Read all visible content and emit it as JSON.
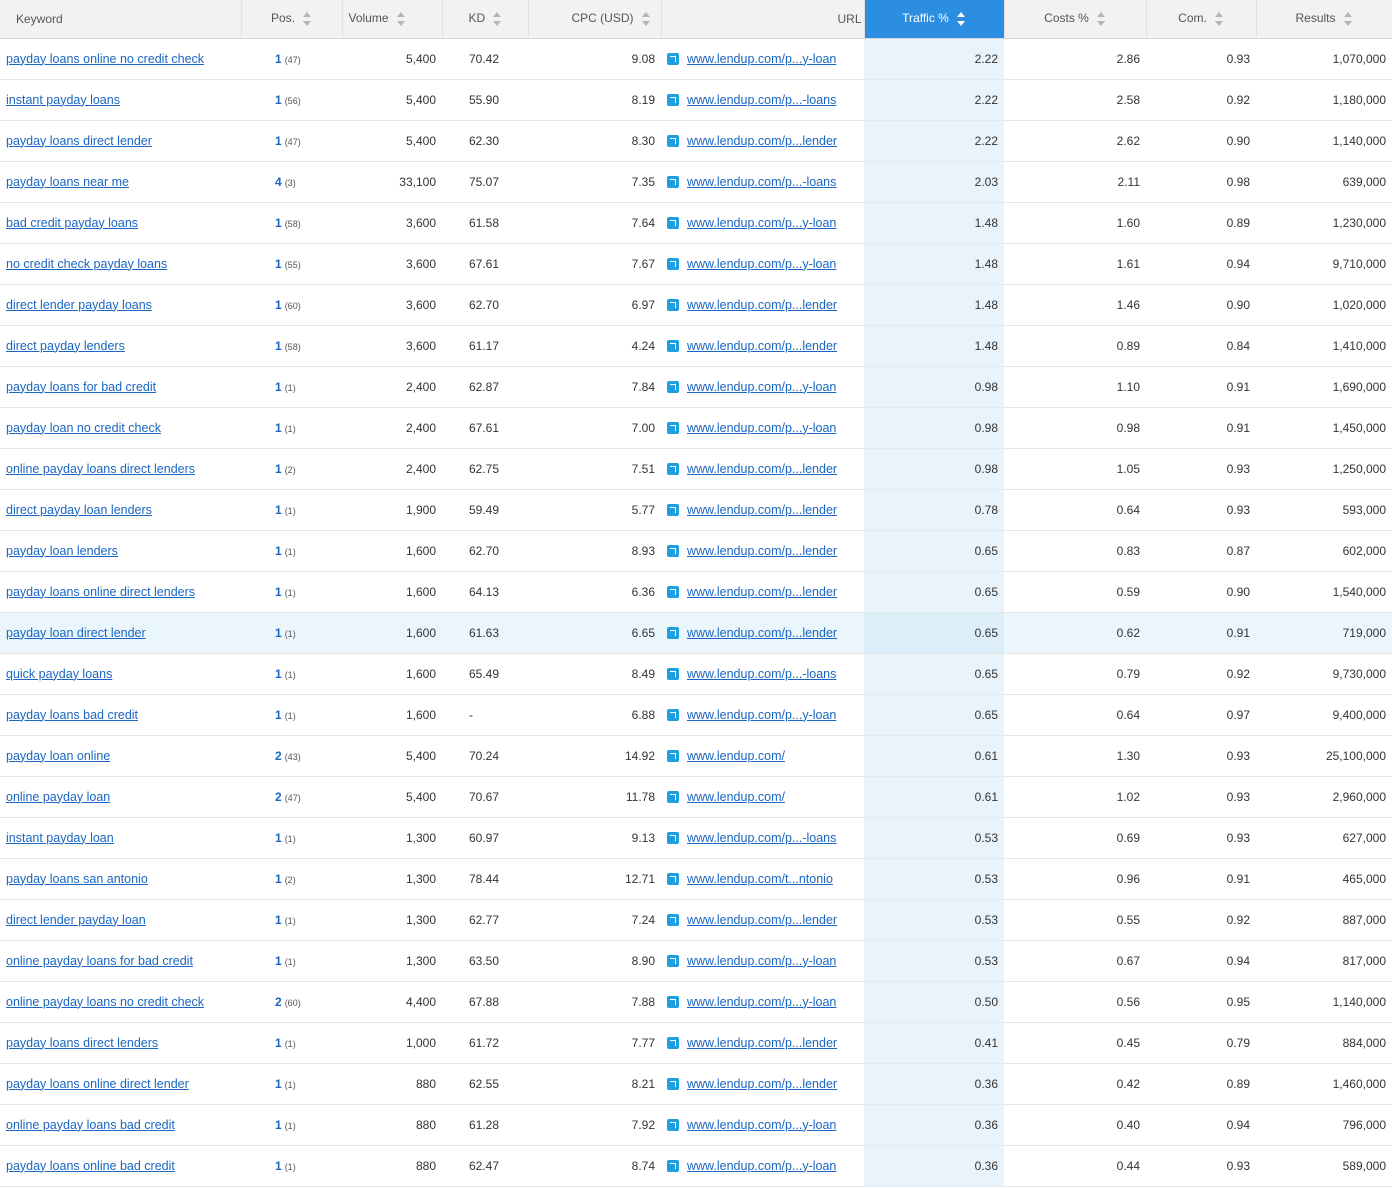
{
  "columns": {
    "keyword": "Keyword",
    "pos": "Pos.",
    "volume": "Volume",
    "kd": "KD",
    "cpc": "CPC (USD)",
    "url": "URL",
    "traffic": "Traffic %",
    "costs": "Costs %",
    "com": "Com.",
    "results": "Results"
  },
  "colors": {
    "sorted_header": "#2b8ee0",
    "link": "#1a66c2",
    "traffic_column": "#e8f3fb",
    "row_hover": "#eaf5fc"
  },
  "rows": [
    {
      "keyword": "payday loans online no credit check",
      "pos": "1",
      "prev": "(47)",
      "volume": "5,400",
      "kd": "70.42",
      "cpc": "9.08",
      "url": "www.lendup.com/p...y-loan",
      "traffic": "2.22",
      "costs": "2.86",
      "com": "0.93",
      "results": "1,070,000"
    },
    {
      "keyword": "instant payday loans",
      "pos": "1",
      "prev": "(56)",
      "volume": "5,400",
      "kd": "55.90",
      "cpc": "8.19",
      "url": "www.lendup.com/p...-loans",
      "traffic": "2.22",
      "costs": "2.58",
      "com": "0.92",
      "results": "1,180,000"
    },
    {
      "keyword": "payday loans direct lender",
      "pos": "1",
      "prev": "(47)",
      "volume": "5,400",
      "kd": "62.30",
      "cpc": "8.30",
      "url": "www.lendup.com/p...lender",
      "traffic": "2.22",
      "costs": "2.62",
      "com": "0.90",
      "results": "1,140,000"
    },
    {
      "keyword": "payday loans near me",
      "pos": "4",
      "prev": "(3)",
      "volume": "33,100",
      "kd": "75.07",
      "cpc": "7.35",
      "url": "www.lendup.com/p...-loans",
      "traffic": "2.03",
      "costs": "2.11",
      "com": "0.98",
      "results": "639,000"
    },
    {
      "keyword": "bad credit payday loans",
      "pos": "1",
      "prev": "(58)",
      "volume": "3,600",
      "kd": "61.58",
      "cpc": "7.64",
      "url": "www.lendup.com/p...y-loan",
      "traffic": "1.48",
      "costs": "1.60",
      "com": "0.89",
      "results": "1,230,000"
    },
    {
      "keyword": "no credit check payday loans",
      "pos": "1",
      "prev": "(55)",
      "volume": "3,600",
      "kd": "67.61",
      "cpc": "7.67",
      "url": "www.lendup.com/p...y-loan",
      "traffic": "1.48",
      "costs": "1.61",
      "com": "0.94",
      "results": "9,710,000"
    },
    {
      "keyword": "direct lender payday loans",
      "pos": "1",
      "prev": "(60)",
      "volume": "3,600",
      "kd": "62.70",
      "cpc": "6.97",
      "url": "www.lendup.com/p...lender",
      "traffic": "1.48",
      "costs": "1.46",
      "com": "0.90",
      "results": "1,020,000"
    },
    {
      "keyword": "direct payday lenders",
      "pos": "1",
      "prev": "(58)",
      "volume": "3,600",
      "kd": "61.17",
      "cpc": "4.24",
      "url": "www.lendup.com/p...lender",
      "traffic": "1.48",
      "costs": "0.89",
      "com": "0.84",
      "results": "1,410,000"
    },
    {
      "keyword": "payday loans for bad credit",
      "pos": "1",
      "prev": "(1)",
      "volume": "2,400",
      "kd": "62.87",
      "cpc": "7.84",
      "url": "www.lendup.com/p...y-loan",
      "traffic": "0.98",
      "costs": "1.10",
      "com": "0.91",
      "results": "1,690,000"
    },
    {
      "keyword": "payday loan no credit check",
      "pos": "1",
      "prev": "(1)",
      "volume": "2,400",
      "kd": "67.61",
      "cpc": "7.00",
      "url": "www.lendup.com/p...y-loan",
      "traffic": "0.98",
      "costs": "0.98",
      "com": "0.91",
      "results": "1,450,000"
    },
    {
      "keyword": "online payday loans direct lenders",
      "pos": "1",
      "prev": "(2)",
      "volume": "2,400",
      "kd": "62.75",
      "cpc": "7.51",
      "url": "www.lendup.com/p...lender",
      "traffic": "0.98",
      "costs": "1.05",
      "com": "0.93",
      "results": "1,250,000"
    },
    {
      "keyword": "direct payday loan lenders",
      "pos": "1",
      "prev": "(1)",
      "volume": "1,900",
      "kd": "59.49",
      "cpc": "5.77",
      "url": "www.lendup.com/p...lender",
      "traffic": "0.78",
      "costs": "0.64",
      "com": "0.93",
      "results": "593,000"
    },
    {
      "keyword": "payday loan lenders",
      "pos": "1",
      "prev": "(1)",
      "volume": "1,600",
      "kd": "62.70",
      "cpc": "8.93",
      "url": "www.lendup.com/p...lender",
      "traffic": "0.65",
      "costs": "0.83",
      "com": "0.87",
      "results": "602,000"
    },
    {
      "keyword": "payday loans online direct lenders",
      "pos": "1",
      "prev": "(1)",
      "volume": "1,600",
      "kd": "64.13",
      "cpc": "6.36",
      "url": "www.lendup.com/p...lender",
      "traffic": "0.65",
      "costs": "0.59",
      "com": "0.90",
      "results": "1,540,000"
    },
    {
      "keyword": "payday loan direct lender",
      "pos": "1",
      "prev": "(1)",
      "volume": "1,600",
      "kd": "61.63",
      "cpc": "6.65",
      "url": "www.lendup.com/p...lender",
      "traffic": "0.65",
      "costs": "0.62",
      "com": "0.91",
      "results": "719,000",
      "hovered": true
    },
    {
      "keyword": "quick payday loans",
      "pos": "1",
      "prev": "(1)",
      "volume": "1,600",
      "kd": "65.49",
      "cpc": "8.49",
      "url": "www.lendup.com/p...-loans",
      "traffic": "0.65",
      "costs": "0.79",
      "com": "0.92",
      "results": "9,730,000"
    },
    {
      "keyword": "payday loans bad credit",
      "pos": "1",
      "prev": "(1)",
      "volume": "1,600",
      "kd": "-",
      "cpc": "6.88",
      "url": "www.lendup.com/p...y-loan",
      "traffic": "0.65",
      "costs": "0.64",
      "com": "0.97",
      "results": "9,400,000"
    },
    {
      "keyword": "payday loan online",
      "pos": "2",
      "prev": "(43)",
      "volume": "5,400",
      "kd": "70.24",
      "cpc": "14.92",
      "url": "www.lendup.com/",
      "traffic": "0.61",
      "costs": "1.30",
      "com": "0.93",
      "results": "25,100,000"
    },
    {
      "keyword": "online payday loan",
      "pos": "2",
      "prev": "(47)",
      "volume": "5,400",
      "kd": "70.67",
      "cpc": "11.78",
      "url": "www.lendup.com/",
      "traffic": "0.61",
      "costs": "1.02",
      "com": "0.93",
      "results": "2,960,000"
    },
    {
      "keyword": "instant payday loan",
      "pos": "1",
      "prev": "(1)",
      "volume": "1,300",
      "kd": "60.97",
      "cpc": "9.13",
      "url": "www.lendup.com/p...-loans",
      "traffic": "0.53",
      "costs": "0.69",
      "com": "0.93",
      "results": "627,000"
    },
    {
      "keyword": "payday loans san antonio",
      "pos": "1",
      "prev": "(2)",
      "volume": "1,300",
      "kd": "78.44",
      "cpc": "12.71",
      "url": "www.lendup.com/t...ntonio",
      "traffic": "0.53",
      "costs": "0.96",
      "com": "0.91",
      "results": "465,000"
    },
    {
      "keyword": "direct lender payday loan",
      "pos": "1",
      "prev": "(1)",
      "volume": "1,300",
      "kd": "62.77",
      "cpc": "7.24",
      "url": "www.lendup.com/p...lender",
      "traffic": "0.53",
      "costs": "0.55",
      "com": "0.92",
      "results": "887,000"
    },
    {
      "keyword": "online payday loans for bad credit",
      "pos": "1",
      "prev": "(1)",
      "volume": "1,300",
      "kd": "63.50",
      "cpc": "8.90",
      "url": "www.lendup.com/p...y-loan",
      "traffic": "0.53",
      "costs": "0.67",
      "com": "0.94",
      "results": "817,000"
    },
    {
      "keyword": "online payday loans no credit check",
      "pos": "2",
      "prev": "(60)",
      "volume": "4,400",
      "kd": "67.88",
      "cpc": "7.88",
      "url": "www.lendup.com/p...y-loan",
      "traffic": "0.50",
      "costs": "0.56",
      "com": "0.95",
      "results": "1,140,000"
    },
    {
      "keyword": "payday loans direct lenders",
      "pos": "1",
      "prev": "(1)",
      "volume": "1,000",
      "kd": "61.72",
      "cpc": "7.77",
      "url": "www.lendup.com/p...lender",
      "traffic": "0.41",
      "costs": "0.45",
      "com": "0.79",
      "results": "884,000"
    },
    {
      "keyword": "payday loans online direct lender",
      "pos": "1",
      "prev": "(1)",
      "volume": "880",
      "kd": "62.55",
      "cpc": "8.21",
      "url": "www.lendup.com/p...lender",
      "traffic": "0.36",
      "costs": "0.42",
      "com": "0.89",
      "results": "1,460,000"
    },
    {
      "keyword": "online payday loans bad credit",
      "pos": "1",
      "prev": "(1)",
      "volume": "880",
      "kd": "61.28",
      "cpc": "7.92",
      "url": "www.lendup.com/p...y-loan",
      "traffic": "0.36",
      "costs": "0.40",
      "com": "0.94",
      "results": "796,000"
    },
    {
      "keyword": "payday loans online bad credit",
      "pos": "1",
      "prev": "(1)",
      "volume": "880",
      "kd": "62.47",
      "cpc": "8.74",
      "url": "www.lendup.com/p...y-loan",
      "traffic": "0.36",
      "costs": "0.44",
      "com": "0.93",
      "results": "589,000"
    }
  ]
}
